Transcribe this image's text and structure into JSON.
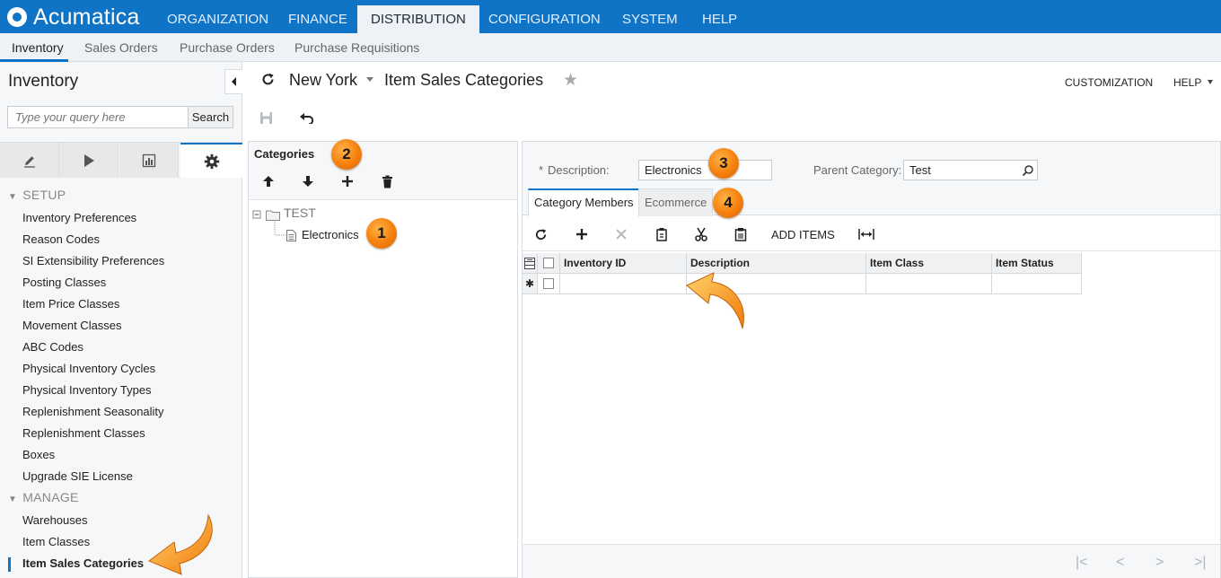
{
  "topbar": {
    "logo_text": "Acumatica",
    "nav": [
      "ORGANIZATION",
      "FINANCE",
      "DISTRIBUTION",
      "CONFIGURATION",
      "SYSTEM",
      "HELP"
    ],
    "active_index": 2
  },
  "subnav": {
    "items": [
      "Inventory",
      "Sales Orders",
      "Purchase Orders",
      "Purchase Requisitions"
    ],
    "active_index": 0
  },
  "sidebar": {
    "title": "Inventory",
    "search_placeholder": "Type your query here",
    "search_button": "Search",
    "mode_tab_icons": [
      "pencil-icon",
      "play-icon",
      "chart-icon",
      "gear-icon"
    ],
    "active_mode_tab": 3,
    "sections": [
      {
        "label": "SETUP",
        "items": [
          "Inventory Preferences",
          "Reason Codes",
          "SI Extensibility Preferences",
          "Posting Classes",
          "Item Price Classes",
          "Movement Classes",
          "ABC Codes",
          "Physical Inventory Cycles",
          "Physical Inventory Types",
          "Replenishment Seasonality",
          "Replenishment Classes",
          "Boxes",
          "Upgrade SIE License"
        ]
      },
      {
        "label": "MANAGE",
        "items": [
          "Warehouses",
          "Item Classes",
          "Item Sales Categories"
        ]
      }
    ],
    "active_item": "Item Sales Categories"
  },
  "header": {
    "company": "New York",
    "screen_title": "Item Sales Categories",
    "customization": "CUSTOMIZATION",
    "help": "HELP"
  },
  "categories": {
    "title": "Categories",
    "toolbar_icons": [
      "arrow-up-icon",
      "arrow-down-icon",
      "add-icon",
      "delete-icon"
    ],
    "tree_root": "TEST",
    "tree_child": "Electronics"
  },
  "form": {
    "description_label": "Description:",
    "required_mark": "*",
    "description_value": "Electronics",
    "parent_label": "Parent Category:",
    "parent_value": "Test"
  },
  "tabs": [
    "Category Members",
    "Ecommerce"
  ],
  "grid_toolbar": {
    "icons": [
      "refresh-icon",
      "add-icon",
      "delete-icon",
      "copy-icon",
      "cut-icon",
      "paste-icon",
      "fit-columns-icon"
    ],
    "add_items_label": "ADD ITEMS"
  },
  "grid": {
    "columns": [
      "Inventory ID",
      "Description",
      "Item Class",
      "Item Status"
    ],
    "new_row_marker": "✱"
  },
  "callouts": [
    "1",
    "2",
    "3",
    "4"
  ],
  "colors": {
    "accent": "#0f73c6",
    "callout": "#f57f0c"
  }
}
